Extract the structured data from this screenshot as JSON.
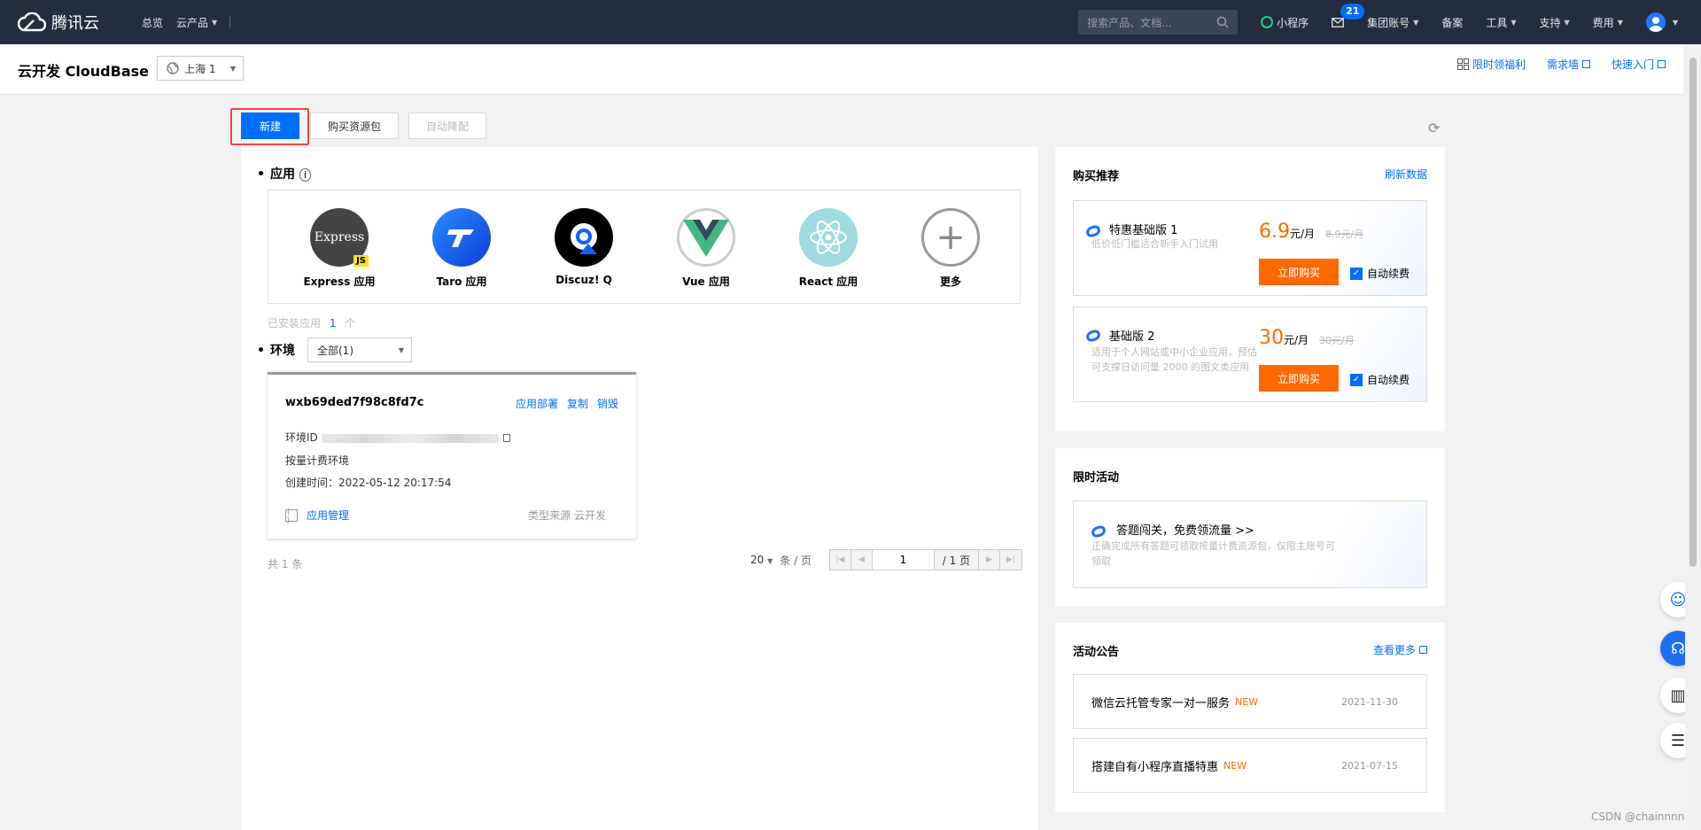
{
  "topnav": {
    "logo_text": "腾讯云",
    "items": [
      {
        "label": "总览",
        "has_caret": false
      },
      {
        "label": "云产品",
        "has_caret": true
      }
    ],
    "search_placeholder": "搜索产品、文档...",
    "mini_program": "小程序",
    "mail_count": "21",
    "right_items": [
      {
        "label": "集团账号",
        "has_caret": true
      },
      {
        "label": "备案",
        "has_caret": false
      },
      {
        "label": "工具",
        "has_caret": true
      },
      {
        "label": "支持",
        "has_caret": true
      },
      {
        "label": "费用",
        "has_caret": true
      }
    ]
  },
  "subheader": {
    "title": "云开发 CloudBase",
    "region": "上海 1",
    "links": [
      "限时领福利",
      "需求墙",
      "快速入门"
    ]
  },
  "toolbar": {
    "new_label": "新建",
    "buy_label": "购买资源包",
    "auto_label": "自动降配"
  },
  "apps": {
    "section_label": "应用",
    "items": [
      {
        "name": "Express 应用",
        "icon": "express-icon"
      },
      {
        "name": "Taro 应用",
        "icon": "taro-icon"
      },
      {
        "name": "Discuz! Q",
        "icon": "discuz-icon"
      },
      {
        "name": "Vue 应用",
        "icon": "vue-icon"
      },
      {
        "name": "React 应用",
        "icon": "react-icon"
      },
      {
        "name": "更多",
        "icon": "plus-icon"
      }
    ],
    "installed_label": "已安装应用",
    "installed_count": "1",
    "installed_unit": "个"
  },
  "env": {
    "section_label": "环境",
    "filter": "全部(1)",
    "card": {
      "name": "wxb69ded7f98c8fd7c",
      "actions": [
        "应用部署",
        "复制",
        "销毁"
      ],
      "id_label": "环境ID",
      "billing": "按量计费环境",
      "created": "创建时间：2022-05-12 20:17:54",
      "manage": "应用管理",
      "source": "类型来源  云开发"
    },
    "total": "共 1 条",
    "page_size": "20",
    "page_size_unit": "条 / 页",
    "page": "1",
    "page_total": "/ 1 页"
  },
  "purchase": {
    "title": "购买推荐",
    "refresh": "刷新数据",
    "offers": [
      {
        "name": "特惠基础版 1",
        "desc": "低价低门槛适合新手入门试用",
        "price": "6.9",
        "unit": "元/月",
        "old": "8.9元/月",
        "buy": "立即购买",
        "renew": "自动续费"
      },
      {
        "name": "基础版 2",
        "desc": "适用于个人网站或中小企业应用，预估可支撑日访问量 2000 的图文类应用",
        "price": "30",
        "unit": "元/月",
        "old": "30元/月",
        "buy": "立即购买",
        "renew": "自动续费"
      }
    ]
  },
  "activity": {
    "title": "限时活动",
    "item_title": "答题闯关，免费领流量 >>",
    "item_desc": "正确完成所有答题可领取按量计费资源包，仅限主账号可领取"
  },
  "notices": {
    "title": "活动公告",
    "more": "查看更多",
    "items": [
      {
        "title": "微信云托管专家一对一服务",
        "badge": "NEW",
        "date": "2021-11-30"
      },
      {
        "title": "搭建自有小程序直播特惠",
        "badge": "NEW",
        "date": "2021-07-15"
      }
    ]
  },
  "watermark": "CSDN @chainnnn"
}
